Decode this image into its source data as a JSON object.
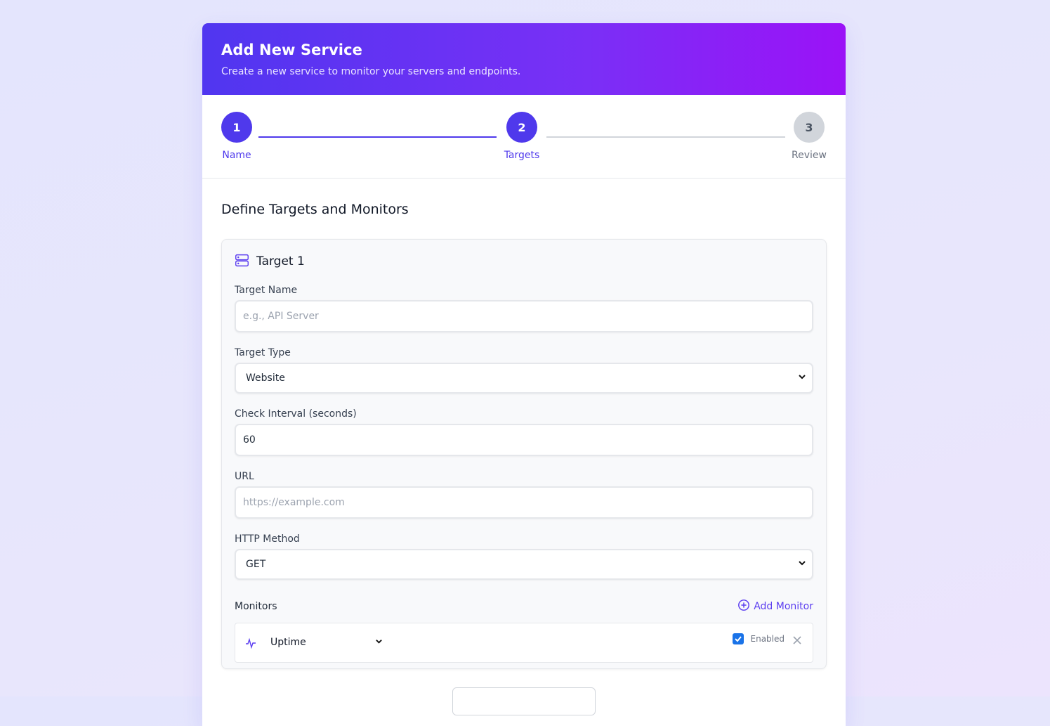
{
  "header": {
    "title": "Add New Service",
    "subtitle": "Create a new service to monitor your servers and endpoints."
  },
  "steps": [
    {
      "number": "1",
      "label": "Name",
      "state": "complete"
    },
    {
      "number": "2",
      "label": "Targets",
      "state": "active"
    },
    {
      "number": "3",
      "label": "Review",
      "state": "upcoming"
    }
  ],
  "section_title": "Define Targets and Monitors",
  "target": {
    "icon": "server-icon",
    "title": "Target 1",
    "name_label": "Target Name",
    "name_placeholder": "e.g., API Server",
    "type_label": "Target Type",
    "type_value": "Website",
    "interval_label": "Check Interval (seconds)",
    "interval_value": "60",
    "url_label": "URL",
    "url_placeholder": "https://example.com",
    "method_label": "HTTP Method",
    "method_value": "GET"
  },
  "monitors": {
    "label": "Monitors",
    "add_label": "Add Monitor",
    "items": [
      {
        "icon": "pulse-icon",
        "type": "Uptime",
        "enabled_label": "Enabled",
        "enabled": true
      }
    ]
  },
  "colors": {
    "accent": "#4f39ec",
    "gradient_start": "#5036f0",
    "gradient_end": "#9b12f7",
    "checkbox": "#1a73e8"
  }
}
